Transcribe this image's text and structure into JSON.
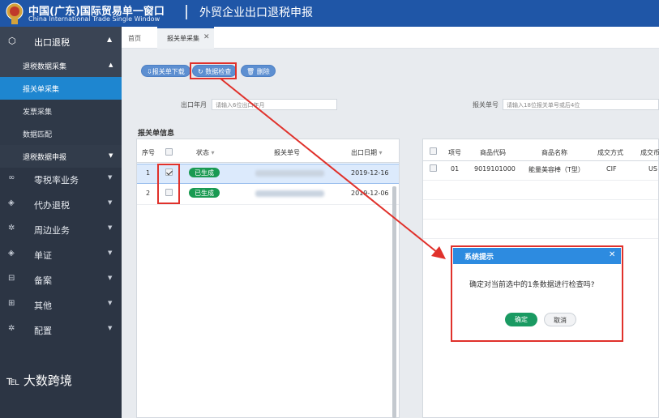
{
  "header": {
    "title_cn": "中国(广东)国际贸易单一窗口",
    "title_en": "China International Trade Single Window",
    "subtitle": "外贸企业出口退税申报",
    "logo_icon": "emblem-icon"
  },
  "sidebar": {
    "top_item": {
      "label": "出口退税",
      "icon": "cube-icon"
    },
    "group": {
      "label": "退税数据采集"
    },
    "sub_items": [
      {
        "label": "报关单采集",
        "active": true
      },
      {
        "label": "发票采集",
        "active": false
      },
      {
        "label": "数据匹配",
        "active": false
      }
    ],
    "group2": {
      "label": "退税数据申报"
    },
    "nav_items": [
      {
        "label": "零税率业务",
        "icon": "infinity-icon"
      },
      {
        "label": "代办退税",
        "icon": "layers-icon"
      },
      {
        "label": "周边业务",
        "icon": "gear-icon"
      },
      {
        "label": "单证",
        "icon": "layers-icon"
      },
      {
        "label": "备案",
        "icon": "car-icon"
      },
      {
        "label": "其他",
        "icon": "grid-icon"
      },
      {
        "label": "配置",
        "icon": "gear-icon"
      }
    ],
    "watermark": "大数跨境"
  },
  "tabs": {
    "home": "首页",
    "active": "报关单采集",
    "close": "✕"
  },
  "toolbar": {
    "download": "⇩报关单下载",
    "check": "数据检查",
    "delete": "删除"
  },
  "filters": {
    "export_month_label": "出口年月",
    "export_month_placeholder": "请输入6位出口年月",
    "declaration_no_label": "报关单号",
    "declaration_no_placeholder": "请输入18位报关单号或后4位"
  },
  "left_table": {
    "section_title": "报关单信息",
    "headers": {
      "seq": "序号",
      "status": "状态",
      "decl_no": "报关单号",
      "date": "出口日期"
    },
    "rows": [
      {
        "seq": "1",
        "checked": true,
        "status": "已生成",
        "date": "2019-12-16"
      },
      {
        "seq": "2",
        "checked": false,
        "status": "已生成",
        "date": "2019-12-06"
      }
    ]
  },
  "right_table": {
    "headers": {
      "item": "项号",
      "code": "商品代码",
      "name": "商品名称",
      "terms": "成交方式",
      "currency": "成交币"
    },
    "rows": [
      {
        "item": "01",
        "code": "9019101000",
        "name": "能量美容棒（T型）",
        "terms": "CIF",
        "currency": "US"
      }
    ]
  },
  "dialog": {
    "title": "系统提示",
    "message": "确定对当前选中的1条数据进行检查吗?",
    "ok": "确定",
    "cancel": "取消"
  },
  "colors": {
    "header_bg": "#1f56a7",
    "sidebar_bg": "#2c3544",
    "active_item": "#1e86d0",
    "status_badge": "#1a9a52",
    "dialog_header": "#2d8be0",
    "annotation_red": "#e0312b"
  }
}
